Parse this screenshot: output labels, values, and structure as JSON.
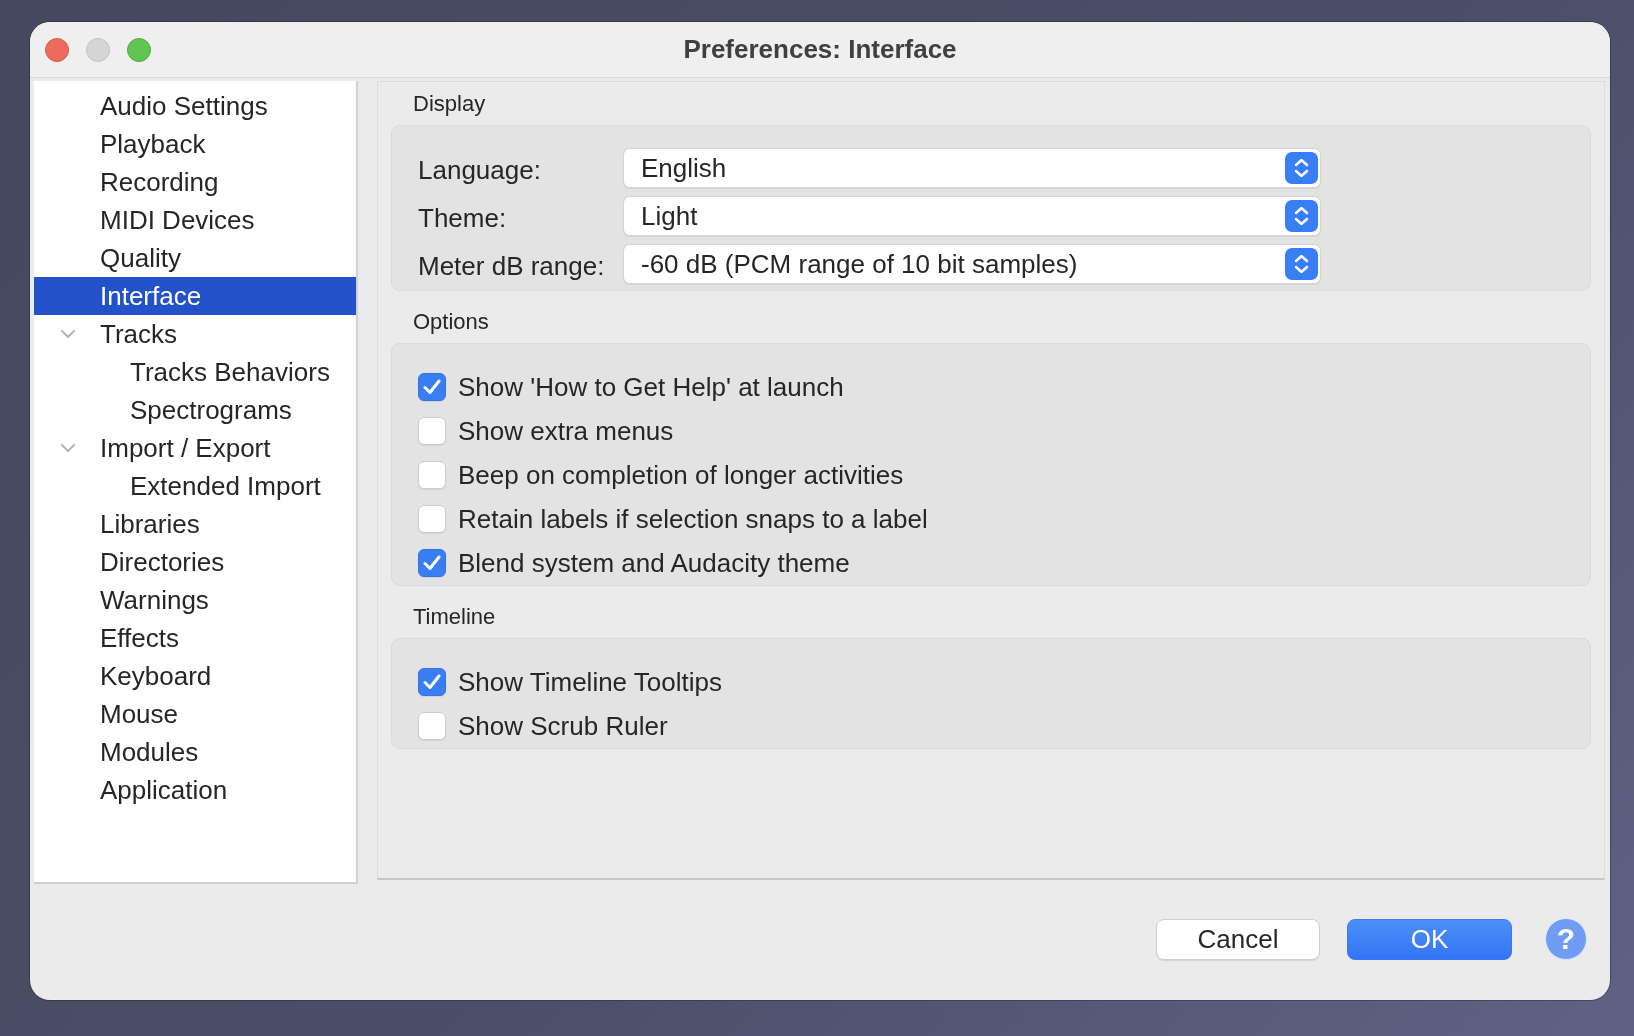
{
  "window": {
    "title": "Preferences: Interface",
    "buttons": [
      {
        "kind": "close",
        "disabled": false
      },
      {
        "kind": "minimize",
        "disabled": true
      },
      {
        "kind": "zoom",
        "disabled": false
      }
    ]
  },
  "sidebar": {
    "items": [
      {
        "label": "Audio Settings",
        "selected": false
      },
      {
        "label": "Playback",
        "selected": false
      },
      {
        "label": "Recording",
        "selected": false
      },
      {
        "label": "MIDI Devices",
        "selected": false
      },
      {
        "label": "Quality",
        "selected": false
      },
      {
        "label": "Interface",
        "selected": true
      },
      {
        "label": "Tracks",
        "selected": false,
        "expanded": true,
        "children": [
          {
            "label": "Tracks Behaviors",
            "selected": false
          },
          {
            "label": "Spectrograms",
            "selected": false
          }
        ]
      },
      {
        "label": "Import / Export",
        "selected": false,
        "expanded": true,
        "children": [
          {
            "label": "Extended Import",
            "selected": false
          }
        ]
      },
      {
        "label": "Libraries",
        "selected": false
      },
      {
        "label": "Directories",
        "selected": false
      },
      {
        "label": "Warnings",
        "selected": false
      },
      {
        "label": "Effects",
        "selected": false
      },
      {
        "label": "Keyboard",
        "selected": false
      },
      {
        "label": "Mouse",
        "selected": false
      },
      {
        "label": "Modules",
        "selected": false
      },
      {
        "label": "Application",
        "selected": false
      }
    ]
  },
  "sections": [
    {
      "title": "Display",
      "kind": "fields",
      "fields": [
        {
          "label": "Language:",
          "value": "English"
        },
        {
          "label": "Theme:",
          "value": "Light"
        },
        {
          "label": "Meter dB range:",
          "value": "-60 dB (PCM range of 10 bit samples)"
        }
      ]
    },
    {
      "title": "Options",
      "kind": "checks",
      "options": [
        {
          "label": "Show 'How to Get Help' at launch",
          "checked": true
        },
        {
          "label": "Show extra menus",
          "checked": false
        },
        {
          "label": "Beep on completion of longer activities",
          "checked": false
        },
        {
          "label": "Retain labels if selection snaps to a label",
          "checked": false
        },
        {
          "label": "Blend system and Audacity theme",
          "checked": true
        }
      ]
    },
    {
      "title": "Timeline",
      "kind": "checks",
      "options": [
        {
          "label": "Show Timeline Tooltips",
          "checked": true
        },
        {
          "label": "Show Scrub Ruler",
          "checked": false
        }
      ]
    }
  ],
  "buttons": [
    {
      "kind": "cancel",
      "label": "Cancel"
    },
    {
      "kind": "confirm",
      "label": "OK"
    }
  ],
  "help_button": {
    "label": "?"
  }
}
